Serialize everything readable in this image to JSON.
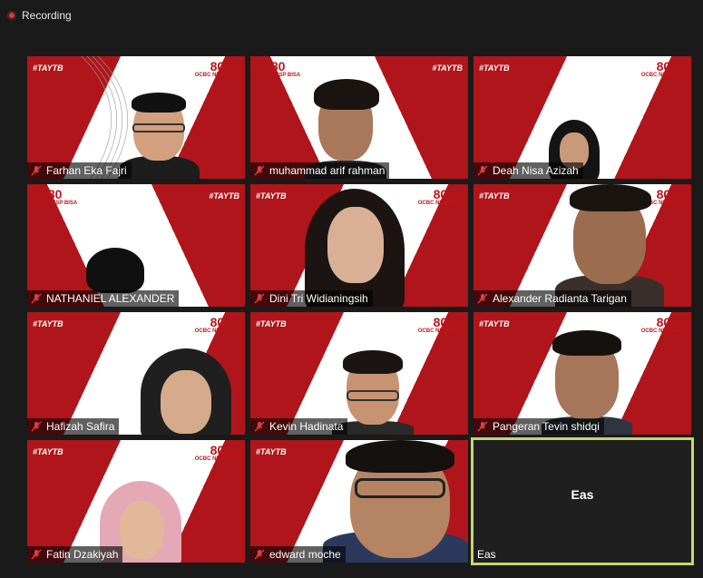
{
  "recording": {
    "label": "Recording"
  },
  "brand": {
    "tag": "#TAYTB",
    "logo_top": "80",
    "logo_text": "OCBC NISP BISA"
  },
  "colors": {
    "brand_red": "#b0151b",
    "active_speaker_border": "#c6d66a",
    "mic_muted": "#e04040"
  },
  "participants": [
    {
      "name": "Farhan Eka Fajri",
      "muted": true
    },
    {
      "name": "muhammad arif rahman",
      "muted": true
    },
    {
      "name": "Deah Nisa Azizah",
      "muted": true
    },
    {
      "name": "NATHANIEL ALEXANDER",
      "muted": true
    },
    {
      "name": "Dini Tri Widianingsih",
      "muted": true
    },
    {
      "name": "Alexander Radianta Tarigan",
      "muted": true
    },
    {
      "name": "Hafizah Safira",
      "muted": true
    },
    {
      "name": "Kevin Hadinata",
      "muted": true
    },
    {
      "name": "Pangeran Tevin shidqi",
      "muted": true
    },
    {
      "name": "Fatin Dzakiyah",
      "muted": true
    },
    {
      "name": "edward moche",
      "muted": true
    },
    {
      "name": "Eas",
      "muted": false,
      "video_off_label": "Eas"
    }
  ]
}
